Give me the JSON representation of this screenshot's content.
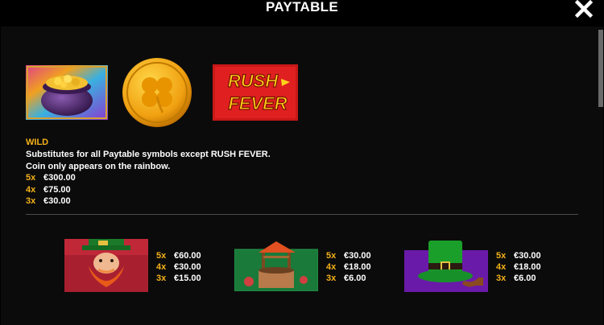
{
  "header": {
    "title": "PAYTABLE",
    "close_icon": "close-icon"
  },
  "wild_section": {
    "rush_fever_logo": [
      "RUSH",
      "FEVER"
    ],
    "label": "WILD",
    "description_line1": "Substitutes for all Paytable symbols except RUSH FEVER.",
    "description_line2": "Coin only appears on the rainbow.",
    "pays": [
      {
        "mult": "5x",
        "value": "€300.00"
      },
      {
        "mult": "4x",
        "value": "€75.00"
      },
      {
        "mult": "3x",
        "value": "€30.00"
      }
    ]
  },
  "symbols": [
    {
      "icon": "leprechaun-icon",
      "pays": [
        {
          "mult": "5x",
          "value": "€60.00"
        },
        {
          "mult": "4x",
          "value": "€30.00"
        },
        {
          "mult": "3x",
          "value": "€15.00"
        }
      ]
    },
    {
      "icon": "wishing-well-icon",
      "pays": [
        {
          "mult": "5x",
          "value": "€30.00"
        },
        {
          "mult": "4x",
          "value": "€18.00"
        },
        {
          "mult": "3x",
          "value": "€6.00"
        }
      ]
    },
    {
      "icon": "hat-pipe-icon",
      "pays": [
        {
          "mult": "5x",
          "value": "€30.00"
        },
        {
          "mult": "4x",
          "value": "€18.00"
        },
        {
          "mult": "3x",
          "value": "€6.00"
        }
      ]
    }
  ],
  "colors": {
    "accent": "#f5b21a",
    "background": "#000000",
    "panel": "#0b0b0b"
  }
}
